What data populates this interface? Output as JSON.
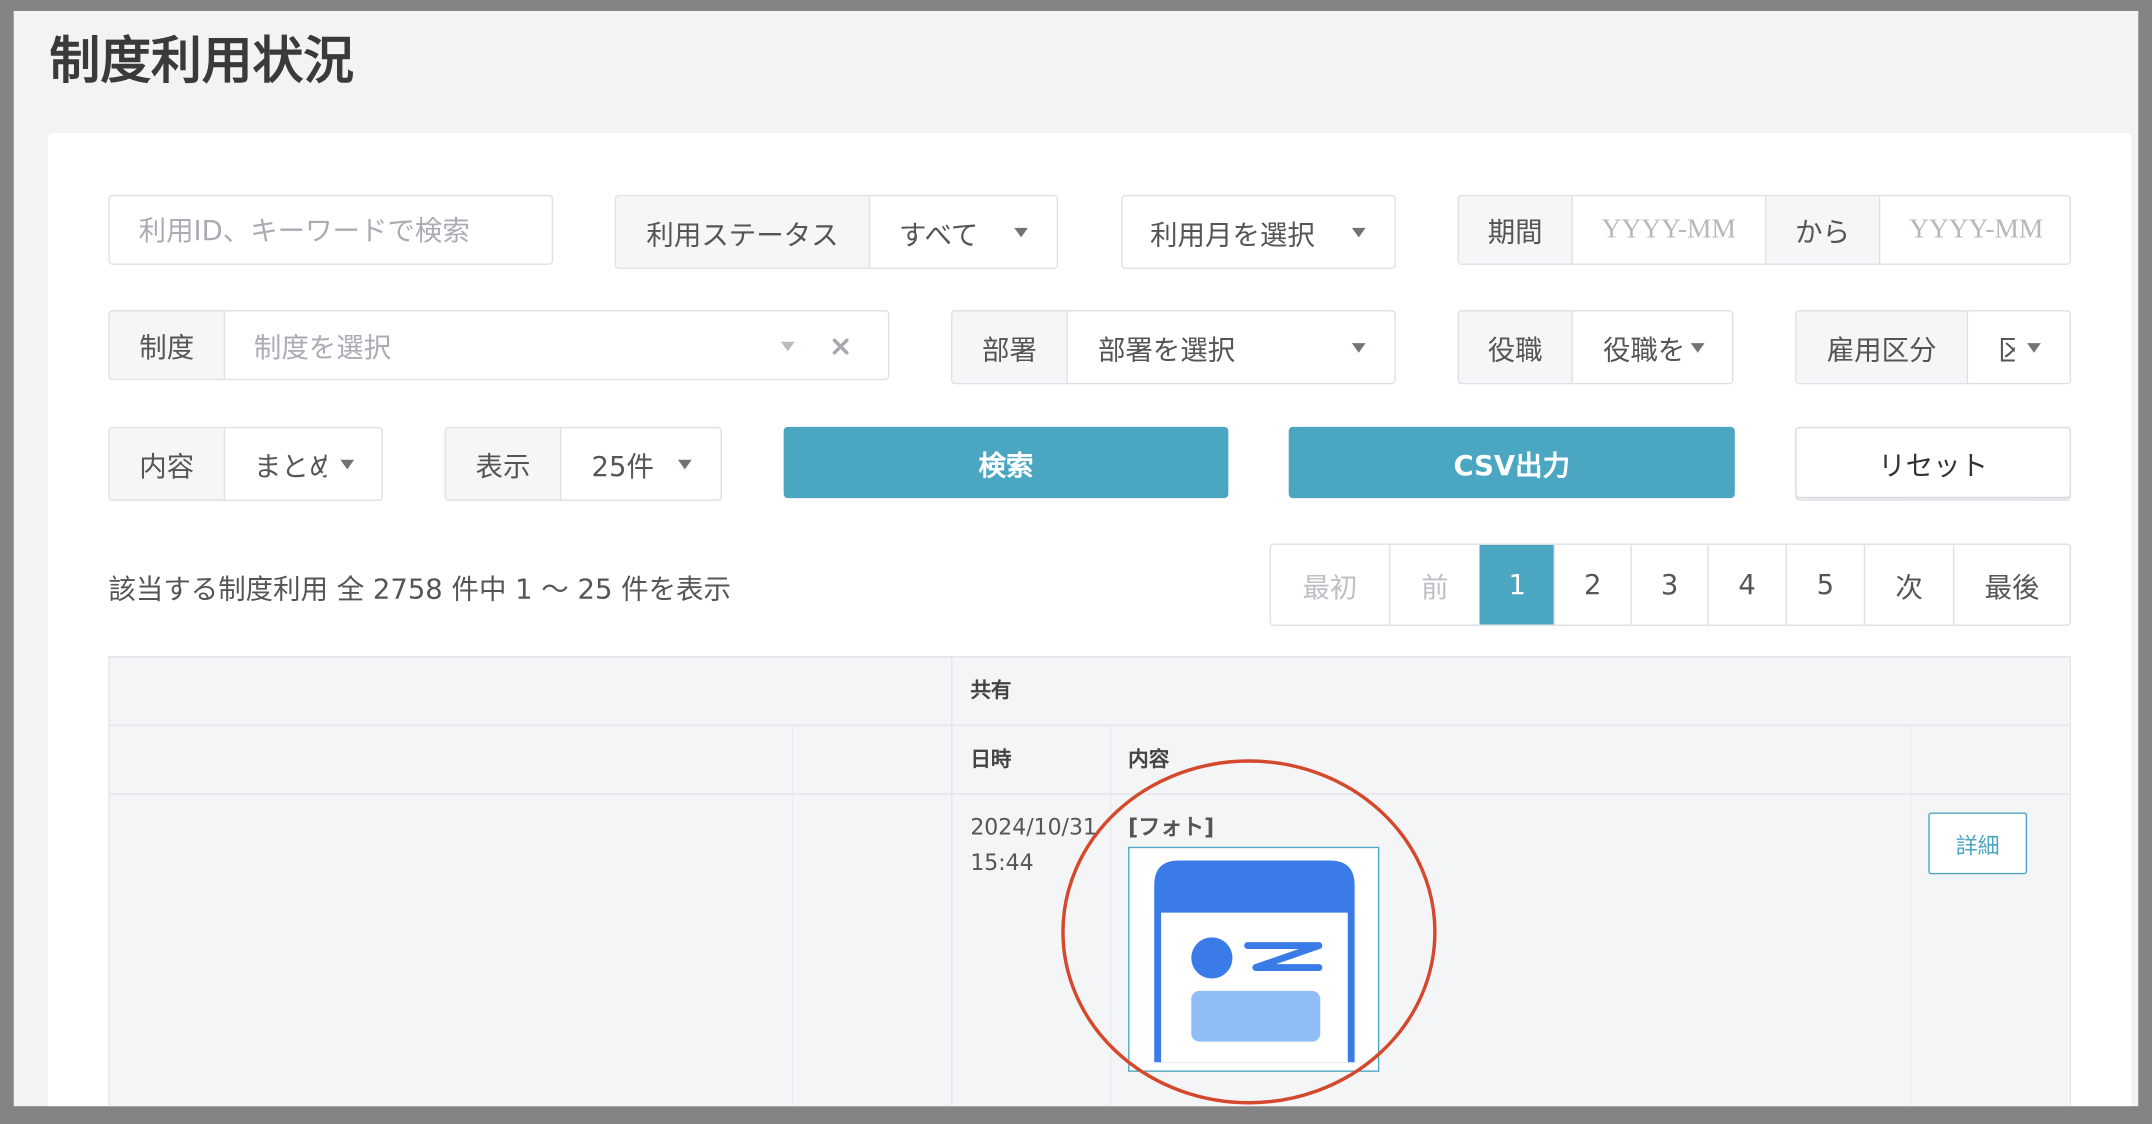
{
  "page": {
    "title": "制度利用状況"
  },
  "filters": {
    "keyword": {
      "placeholder": "利用ID、キーワードで検索"
    },
    "status": {
      "label": "利用ステータス",
      "value": "すべて"
    },
    "month": {
      "value": "利用月を選択"
    },
    "period": {
      "label": "期間",
      "from_placeholder": "YYYY-MM",
      "separator": "から",
      "to_placeholder": "YYYY-MM"
    },
    "program": {
      "label": "制度",
      "placeholder": "制度を選択"
    },
    "department": {
      "label": "部署",
      "value": "部署を選択"
    },
    "position": {
      "label": "役職",
      "value": "役職を"
    },
    "employment": {
      "label": "雇用区分",
      "value": "区"
    },
    "content": {
      "label": "内容",
      "value": "まとめ"
    },
    "display": {
      "label": "表示",
      "value": "25件"
    }
  },
  "actions": {
    "search": "検索",
    "csv": "CSV出力",
    "reset": "リセット"
  },
  "summary": "該当する制度利用 全 2758 件中 1 〜 25 件を表示",
  "pagination": {
    "first": "最初",
    "prev": "前",
    "pages": [
      "1",
      "2",
      "3",
      "4",
      "5"
    ],
    "current": "1",
    "next": "次",
    "last": "最後"
  },
  "table": {
    "group_header": "共有",
    "columns": {
      "datetime": "日時",
      "content": "内容"
    },
    "rows": [
      {
        "date": "2024/10/31",
        "time": "15:44",
        "content_type": "[フォト]",
        "detail": "詳細"
      }
    ]
  },
  "icons": {
    "dropdown": "caret-down-icon",
    "clear": "close-icon",
    "photo": "photo-thumbnail"
  },
  "colors": {
    "accent": "#4aa6c1",
    "annotation": "#d4482b",
    "icon_primary": "#3b7be8",
    "icon_secondary": "#90bdf7"
  }
}
